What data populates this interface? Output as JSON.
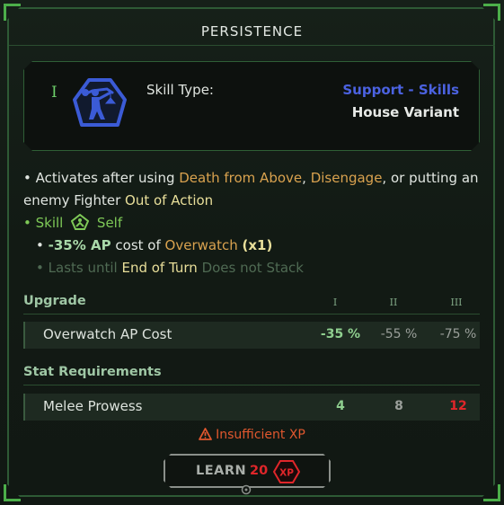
{
  "dialog": {
    "title": "PERSISTENCE"
  },
  "skill": {
    "tier": "I",
    "type_label": "Skill Type:",
    "category": "Support - Skills",
    "variant": "House Variant",
    "icon": "figure-carrying-bag-hexagon-icon",
    "icon_color": "#3b5bd6"
  },
  "description": {
    "line1": {
      "bullet": "•",
      "pre": "Activates after using",
      "ability1": "Death from Above",
      "sep": ",",
      "ability2": "Disengage",
      "post": ", or putting an"
    },
    "line2": {
      "pre": "enemy Fighter",
      "status": "Out of Action"
    },
    "line3": {
      "bullet": "•",
      "kind": "Skill",
      "target": "Self",
      "target_icon": "self-target-shield-icon"
    },
    "line4": {
      "bullet": "•",
      "amount": "-35% AP",
      "mid": "cost of",
      "ability": "Overwatch",
      "mult": "(x1)"
    },
    "line5": {
      "bullet": "•",
      "pre": "Lasts until",
      "duration": "End of Turn",
      "stack": "Does not Stack"
    }
  },
  "upgrade": {
    "header": "Upgrade",
    "levels": [
      "I",
      "II",
      "III"
    ],
    "rows": [
      {
        "label": "Overwatch AP Cost",
        "values": [
          "-35 %",
          "-55 %",
          "-75 %"
        ]
      }
    ]
  },
  "requirements": {
    "header": "Stat Requirements",
    "rows": [
      {
        "label": "Melee Prowess",
        "values": [
          "4",
          "8",
          "12"
        ]
      }
    ]
  },
  "warning": {
    "text": "Insufficient XP",
    "icon": "warning-triangle-icon"
  },
  "learn_button": {
    "label": "LEARN",
    "cost": "20",
    "currency": "XP"
  },
  "colors": {
    "accent_green": "#4caf4a",
    "skill_blue": "#4b62e0",
    "ability_orange": "#d9a24f",
    "warning_red": "#e0572e",
    "cost_red": "#e0262a"
  }
}
